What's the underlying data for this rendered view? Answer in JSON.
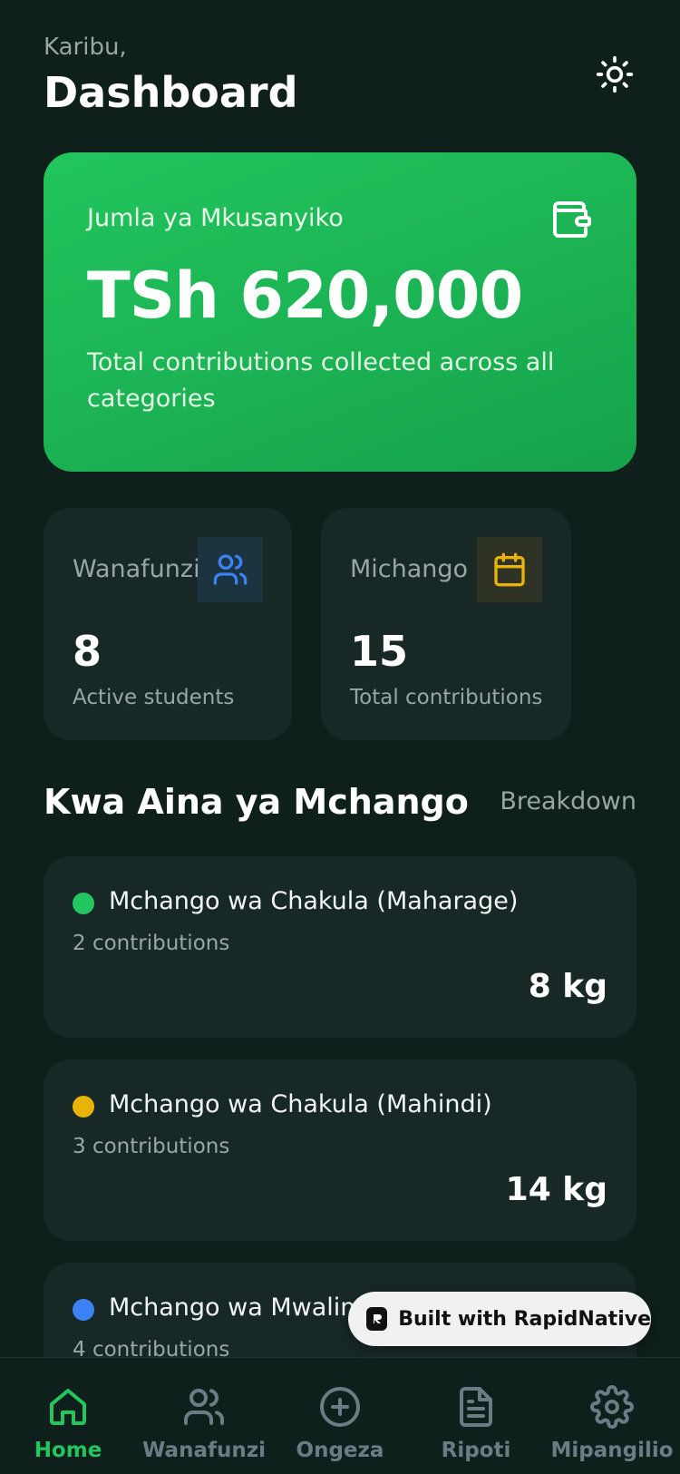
{
  "header": {
    "greeting": "Karibu,",
    "title": "Dashboard",
    "theme_icon": "sun-icon"
  },
  "total_card": {
    "label": "Jumla ya Mkusanyiko",
    "amount": "TSh 620,000",
    "description": "Total contributions collected across all categories",
    "icon": "wallet-icon"
  },
  "stats": {
    "students": {
      "label": "Wanafunzi",
      "value": "8",
      "sub": "Active students",
      "icon": "users-icon",
      "icon_color": "#3b82f6"
    },
    "contributions": {
      "label": "Michango",
      "value": "15",
      "sub": "Total contributions",
      "icon": "calendar-icon",
      "icon_color": "#eab308"
    }
  },
  "section": {
    "title": "Kwa Aina ya Mchango",
    "link": "Breakdown"
  },
  "categories": [
    {
      "name": "Mchango wa Chakula (Maharage)",
      "count": "2 contributions",
      "amount": "8 kg",
      "color": "#22c55e"
    },
    {
      "name": "Mchango wa Chakula (Mahindi)",
      "count": "3 contributions",
      "amount": "14 kg",
      "color": "#eab308"
    },
    {
      "name": "Mchango wa Mwalim",
      "count": "4 contributions",
      "amount": "",
      "color": "#3b82f6"
    }
  ],
  "badge": {
    "text": "Built with RapidNative"
  },
  "nav": [
    {
      "label": "Home",
      "icon": "home-icon",
      "active": true
    },
    {
      "label": "Wanafunzi",
      "icon": "users-icon",
      "active": false
    },
    {
      "label": "Ongeza",
      "icon": "plus-circle-icon",
      "active": false
    },
    {
      "label": "Ripoti",
      "icon": "file-text-icon",
      "active": false
    },
    {
      "label": "Mipangilio",
      "icon": "gear-icon",
      "active": false
    }
  ],
  "colors": {
    "background": "#0f1f1c",
    "card": "#182827",
    "accent": "#22c55e",
    "muted": "#9aa6a3",
    "nav_inactive": "#6b7c84"
  }
}
